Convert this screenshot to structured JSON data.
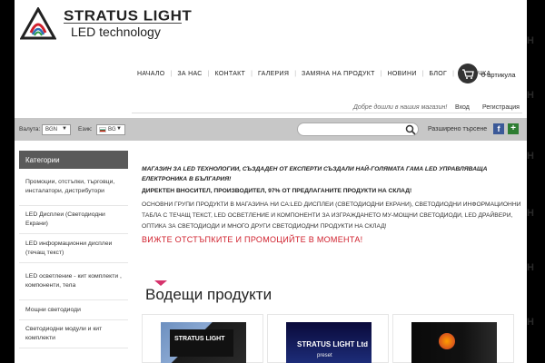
{
  "brand": {
    "name": "STRATUS LIGHT",
    "tagline": "LED technology",
    "logo_icon": "stratus-logo-icon"
  },
  "nav": {
    "items": [
      "НАЧАЛО",
      "ЗА НАС",
      "КОНТАКТ",
      "ГАЛЕРИЯ",
      "ЗАМЯНА НА ПРОДУКТ",
      "НОВИНИ",
      "БЛОГ",
      "КОЛИЧКА"
    ],
    "cart_icon": "cart-icon",
    "cart_count": "0 артикула"
  },
  "account": {
    "welcome": "Добре дошли в нашия магазин!",
    "login": "Вход",
    "register": "Регистрация"
  },
  "toolbar": {
    "currency_label": "Валута:",
    "currency_value": "BGN",
    "language_label": "Език:",
    "language_value": "BG",
    "search_placeholder": "",
    "advanced_search": "Разширено търсене",
    "facebook_icon": "facebook-icon",
    "plus_icon": "plus-icon"
  },
  "sidebar": {
    "title": "Категории",
    "items": [
      "Промоции, отстъпки, търговци, инсталатори, дистрибутори",
      "LED Дисплеи (Светодиодни Екрани)",
      "LED информационни дисплеи (течащ текст)",
      "LED осветление - кит комплекти , компоненти, тела",
      "Мощни светодиоди",
      "Светодиодни модули и кит комплекти"
    ]
  },
  "content": {
    "intro_heading": "МАГАЗИН ЗА LED ТЕХНОЛОГИИ, СЪЗДАДЕН ОТ ЕКСПЕРТИ СЪЗДАЛИ НАЙ-ГОЛЯМАТА ГАМА LED УПРАВЛЯВАЩА ЕЛЕКТРОНИКА В БЪЛГАРИЯ!",
    "intro_direct": "ДИРЕКТЕН ВНОСИТЕЛ, ПРОИЗВОДИТЕЛ, 97% ОТ ПРЕДЛАГАНИТЕ ПРОДУКТИ НА СКЛАД!",
    "intro_groups": "ОСНОВНИ ГРУПИ ПРОДУКТИ В МАГАЗИНА НИ СА:LED ДИСПЛЕИ (СВЕТОДИОДНИ ЕКРАНИ), СВЕТОДИОДНИ ИНФОРМАЦИОННИ ТАБЛА С ТЕЧАЩ ТЕКСТ, LED ОСВЕТЛЕНИЕ И КОМПОНЕНТИ ЗА ИЗГРАЖДАНЕТО МУ-МОЩНИ СВЕТОДИОДИ, LED ДРАЙВЕРИ, ОПТИКА ЗА СВЕТОДИОДИ И МНОГО ДРУГИ СВЕТОДИОДНИ ПРОДУКТИ НА СКЛАД!",
    "promo": "ВИЖТЕ ОТСТЪПКИТЕ И ПРОМОЦИЙТЕ В МОМЕНТА!"
  },
  "featured": {
    "title": "Водещи продукти",
    "products": [
      {
        "image_text": "STRATUS LIGHT"
      },
      {
        "image_text": "STRATUS LIGHT Ltd",
        "image_subtext": "preset"
      },
      {
        "image_text": ""
      }
    ]
  },
  "colors": {
    "accent_red": "#d0202d",
    "accent_pink": "#d6336c",
    "bar_gray": "#c7c7c7",
    "sidebar_head": "#5a5a5a"
  }
}
